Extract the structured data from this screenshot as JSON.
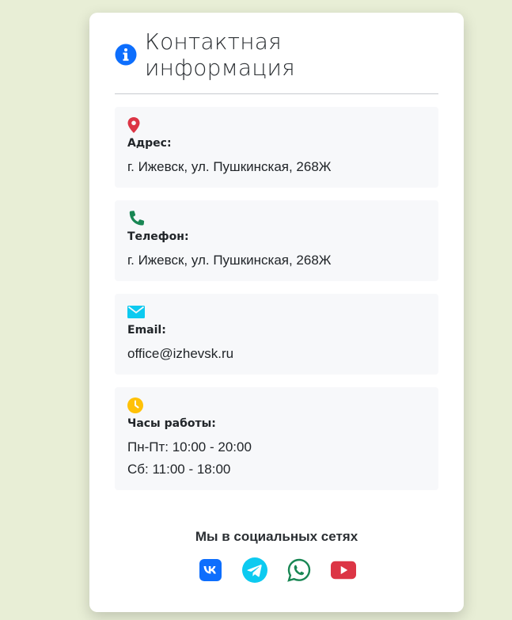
{
  "page": {
    "title": "Контактная информация",
    "title_icon": "info-circle-icon",
    "accent_color": "#0d6efd"
  },
  "info_items": [
    {
      "icon": "map-marker-icon",
      "icon_color": "#dc3545",
      "label": "Адрес:",
      "value": "г. Ижевск, ул. Пушкинская, 268Ж"
    },
    {
      "icon": "phone-icon",
      "icon_color": "#198754",
      "label": "Телефон:",
      "value": "г. Ижевск, ул. Пушкинская, 268Ж"
    },
    {
      "icon": "envelope-icon",
      "icon_color": "#0dcaf0",
      "label": "Email:",
      "value": "office@izhevsk.ru"
    },
    {
      "icon": "clock-icon",
      "icon_color": "#ffc107",
      "label": "Часы работы:",
      "values": [
        "Пн-Пт: 10:00 - 20:00",
        "Сб: 11:00 - 18:00"
      ]
    }
  ],
  "social": {
    "title": "Мы в социальных сетях",
    "links": [
      {
        "icon": "vk-icon",
        "color": "#0d6efd"
      },
      {
        "icon": "telegram-icon",
        "color": "#0dcaf0"
      },
      {
        "icon": "whatsapp-icon",
        "color": "#198754"
      },
      {
        "icon": "youtube-icon",
        "color": "#dc3545"
      }
    ]
  }
}
